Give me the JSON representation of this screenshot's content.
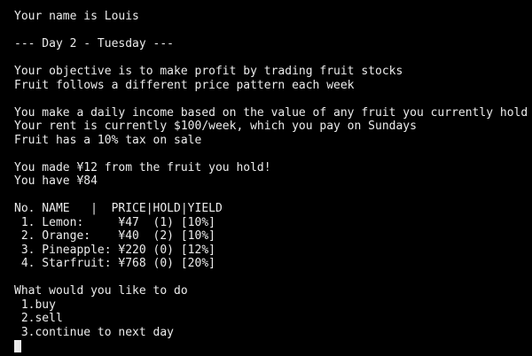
{
  "colors": {
    "background": "#000000",
    "text": "#ececec"
  },
  "intro": {
    "name_line": "Your name is Louis",
    "day_line": "--- Day 2 - Tuesday ---"
  },
  "objective": {
    "line1": "Your objective is to make profit by trading fruit stocks",
    "line2": "Fruit follows a different price pattern each week"
  },
  "rules": {
    "income_line": "You make a daily income based on the value of any fruit you currently hold",
    "rent_line": "Your rent is currently $100/week, which you pay on Sundays",
    "tax_line": "Fruit has a 10% tax on sale"
  },
  "status": {
    "earned_line": "You made ¥12 from the fruit you hold!",
    "balance_line": "You have ¥84"
  },
  "table": {
    "header": "No. NAME   |  PRICE|HOLD|YIELD",
    "rows": [
      " 1. Lemon:     ¥47  (1) [10%]",
      " 2. Orange:    ¥40  (2) [10%]",
      " 3. Pineapple: ¥220 (0) [12%]",
      " 4. Starfruit: ¥768 (0) [20%]"
    ]
  },
  "menu": {
    "prompt": "What would you like to do",
    "options": [
      " 1.buy",
      " 2.sell",
      " 3.continue to next day"
    ]
  }
}
